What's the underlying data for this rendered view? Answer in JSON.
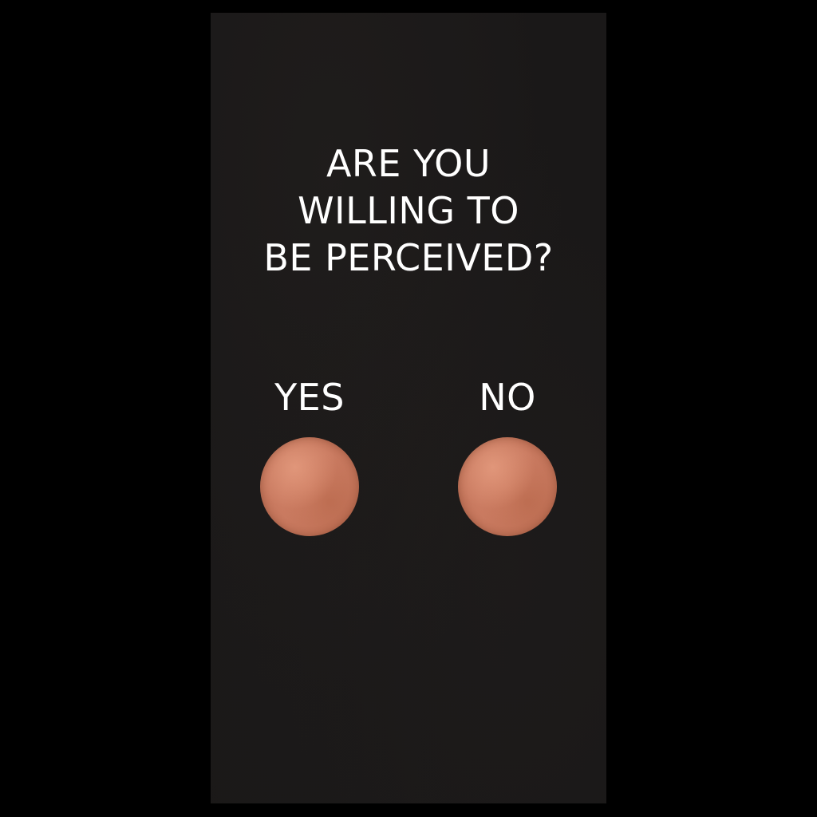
{
  "prompt": {
    "lines": [
      "ARE YOU",
      "WILLING TO",
      "BE PERCEIVED?"
    ]
  },
  "choices": {
    "yes": {
      "label": "YES",
      "button_icon": "copper-circle-button"
    },
    "no": {
      "label": "NO",
      "button_icon": "copper-circle-button"
    }
  },
  "colors": {
    "page_background": "#000000",
    "panel_background": "#1a1818",
    "text": "#ffffff",
    "button": "#c97a60"
  }
}
